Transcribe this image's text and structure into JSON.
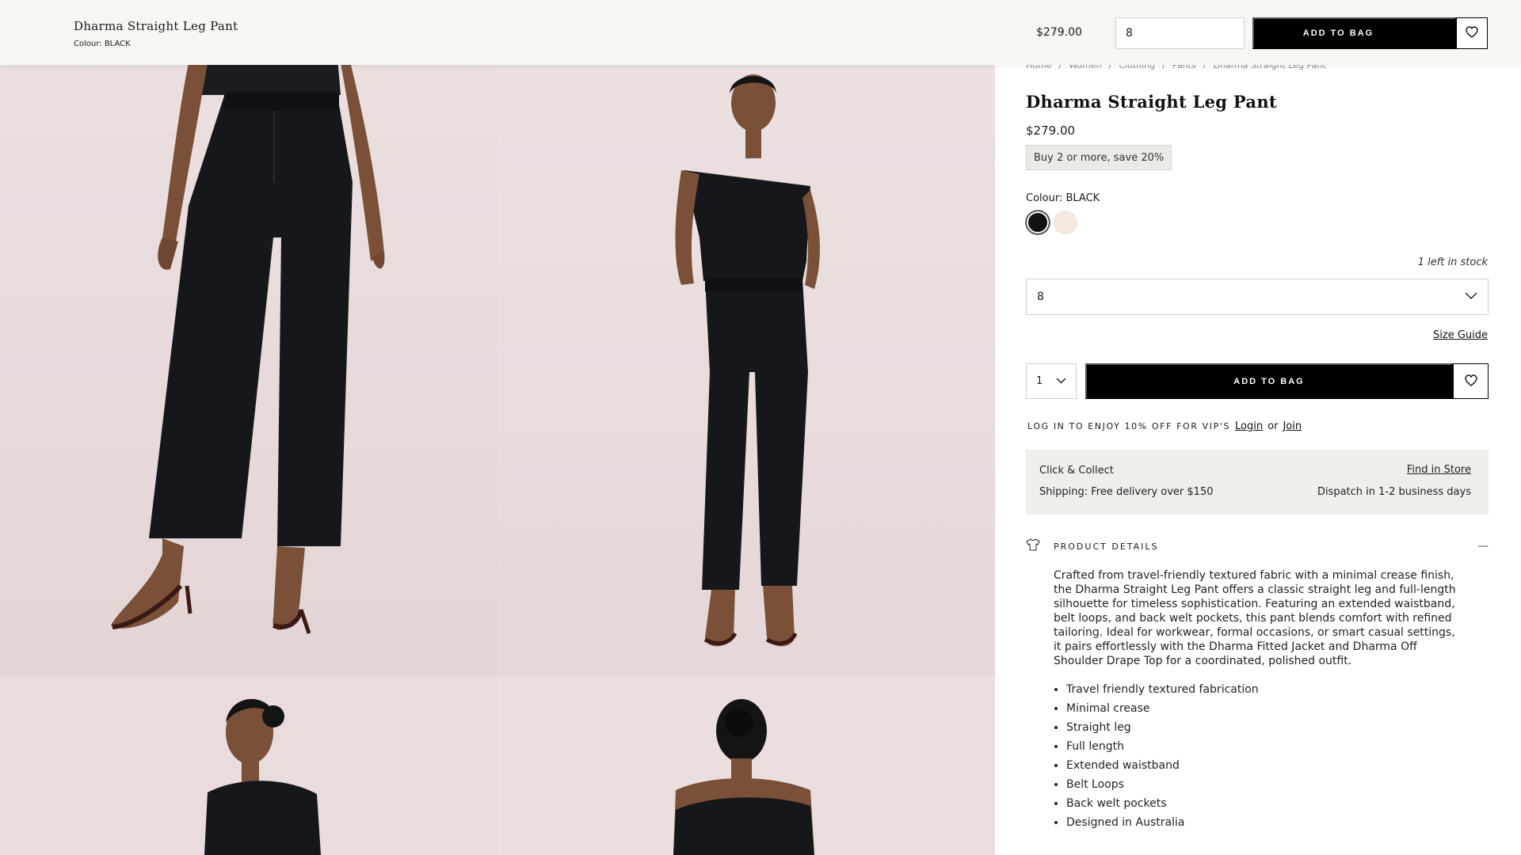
{
  "sticky_header": {
    "product_name": "Dharma Straight Leg Pant",
    "colour_text": "Colour: BLACK",
    "price": "$279.00",
    "size_value": "8",
    "add_to_bag_label": "ADD TO BAG"
  },
  "breadcrumb": {
    "items": [
      "Home",
      "Women",
      "Clothing",
      "Pants",
      "Dharma Straight Leg Pant"
    ],
    "separator": "/"
  },
  "product": {
    "title": "Dharma Straight Leg Pant",
    "price": "$279.00",
    "promo": "Buy 2 or more, save 20%",
    "colour_label": "Colour: BLACK",
    "swatches": [
      {
        "name": "black",
        "color": "#111111"
      },
      {
        "name": "cream",
        "color": "#f4e8df"
      }
    ],
    "stock_note": "1 left in stock",
    "size_selected": "8",
    "size_guide_label": "Size Guide",
    "quantity": "1",
    "add_to_bag_label": "ADD TO BAG",
    "vip_text": "LOG IN TO ENJOY 10% OFF FOR VIP'S",
    "login_label": "Login",
    "or_text": "or",
    "join_label": "Join"
  },
  "delivery": {
    "click_collect": "Click & Collect",
    "find_in_store": "Find in Store",
    "shipping": "Shipping:  Free delivery over $150",
    "dispatch": "Dispatch in 1-2 business days"
  },
  "details": {
    "heading": "PRODUCT DETAILS",
    "collapse_symbol": "—",
    "description": "Crafted from travel-friendly textured fabric with a minimal crease finish, the Dharma Straight Leg Pant offers a classic straight leg and full-length silhouette for timeless sophistication. Featuring an extended waistband, belt loops, and back welt pockets, this pant blends comfort with refined tailoring. Ideal for workwear, formal occasions, or smart casual settings, it pairs effortlessly with the Dharma Fitted Jacket and Dharma Off Shoulder Drape Top for a coordinated, polished outfit.",
    "features": [
      "Travel friendly textured fabrication",
      "Minimal crease",
      "Straight leg",
      "Full length",
      "Extended waistband",
      "Belt Loops",
      "Back welt pockets",
      "Designed in Australia"
    ]
  },
  "icons": {
    "heart": "heart-icon",
    "chevron": "chevron-down-icon",
    "tshirt": "tshirt-icon"
  },
  "colors": {
    "accent": "#000000",
    "header_bg": "#f7f6f3",
    "delivery_bg": "#efeeeb",
    "photo_bg": "#eadcdd"
  }
}
